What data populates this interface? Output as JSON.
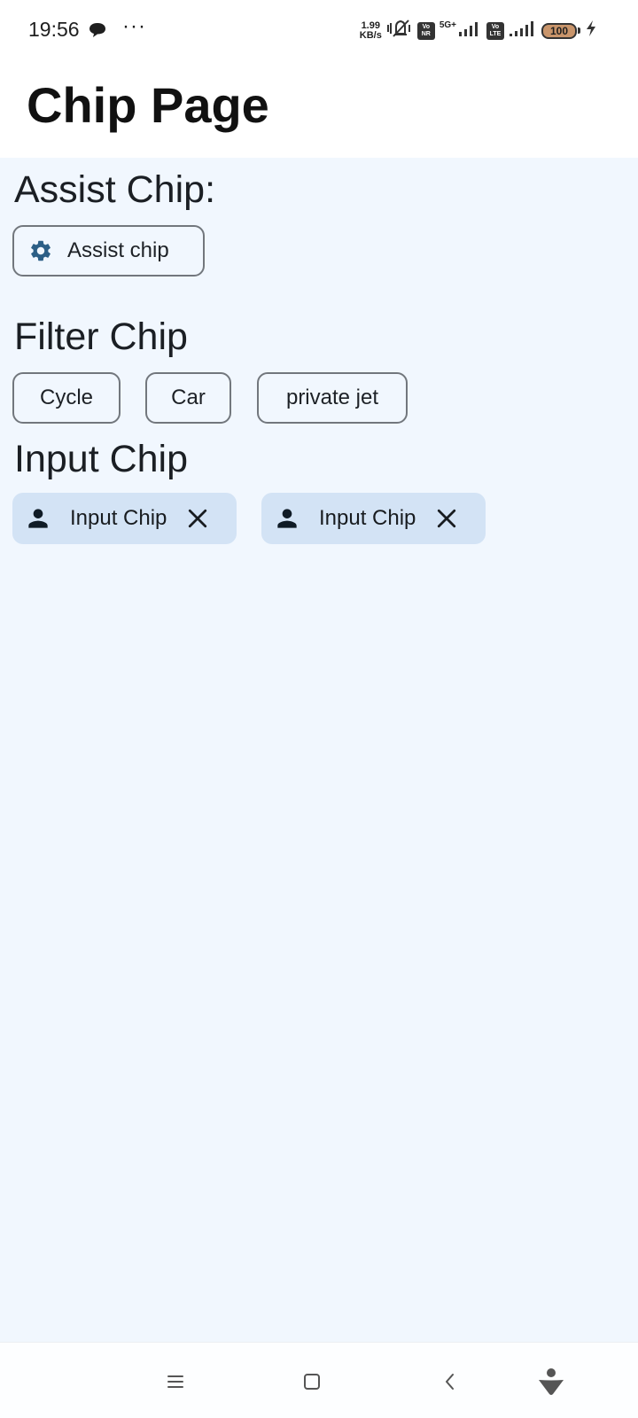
{
  "status_bar": {
    "time": "19:56",
    "net_speed_value": "1.99",
    "net_speed_unit": "KB/s",
    "sim1_top": "Vo",
    "sim1_bottom": "NR",
    "network_gen": "5G+",
    "sim2_top": "Vo",
    "sim2_bottom": "LTE",
    "battery_level": "100"
  },
  "header": {
    "title": "Chip Page"
  },
  "assist_section": {
    "title": "Assist Chip:",
    "chip_label": "Assist chip",
    "chip_icon": "gear-icon"
  },
  "filter_section": {
    "title": "Filter Chip",
    "chips": [
      "Cycle",
      "Car",
      "private jet"
    ]
  },
  "input_section": {
    "title": "Input Chip",
    "chips": [
      {
        "label": "Input Chip",
        "leading_icon": "person-icon",
        "trailing_icon": "close-icon"
      },
      {
        "label": "Input Chip",
        "leading_icon": "person-icon",
        "trailing_icon": "close-icon"
      }
    ]
  },
  "nav_bar": {
    "buttons": [
      "menu-icon",
      "home-icon",
      "back-icon",
      "assistant-icon"
    ]
  },
  "colors": {
    "content_background": "#f1f7fe",
    "input_chip_background": "#d3e3f5",
    "assist_icon": "#2c5f86",
    "chip_outline": "#72777d"
  }
}
